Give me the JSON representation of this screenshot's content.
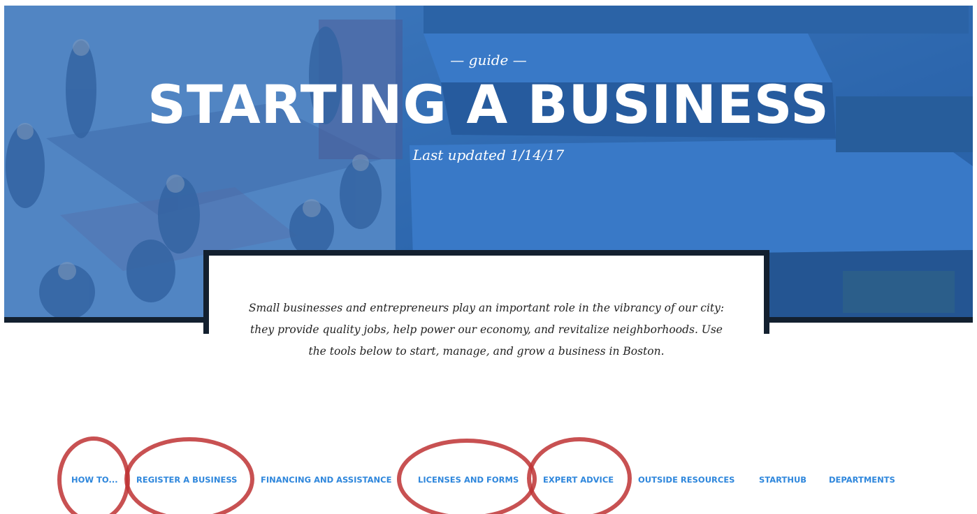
{
  "hero": {
    "kicker": "— guide —",
    "title": "STARTING A BUSINESS",
    "updated": "Last updated 1/14/17"
  },
  "intro": {
    "text": "Small businesses and entrepreneurs play an important role in the vibrancy of our city: they provide quality jobs, help power our economy, and revitalize neighborhoods. Use the tools below to start, manage, and grow a business in Boston."
  },
  "nav": {
    "items": [
      {
        "label": "HOW TO..."
      },
      {
        "label": "REGISTER A BUSINESS"
      },
      {
        "label": "FINANCING AND ASSISTANCE"
      },
      {
        "label": "LICENSES AND FORMS"
      },
      {
        "label": "EXPERT ADVICE"
      },
      {
        "label": "OUTSIDE RESOURCES"
      },
      {
        "label": "STARTHUB"
      },
      {
        "label": "DEPARTMENTS"
      }
    ],
    "highlighted": [
      "HOW TO...",
      "REGISTER A BUSINESS",
      "LICENSES AND FORMS",
      "EXPERT ADVICE"
    ]
  },
  "colors": {
    "nav_link": "#2f87dc",
    "hero_tint": "#2c68b2",
    "highlight_circle": "#be3234",
    "frame_dark": "#13202f"
  }
}
